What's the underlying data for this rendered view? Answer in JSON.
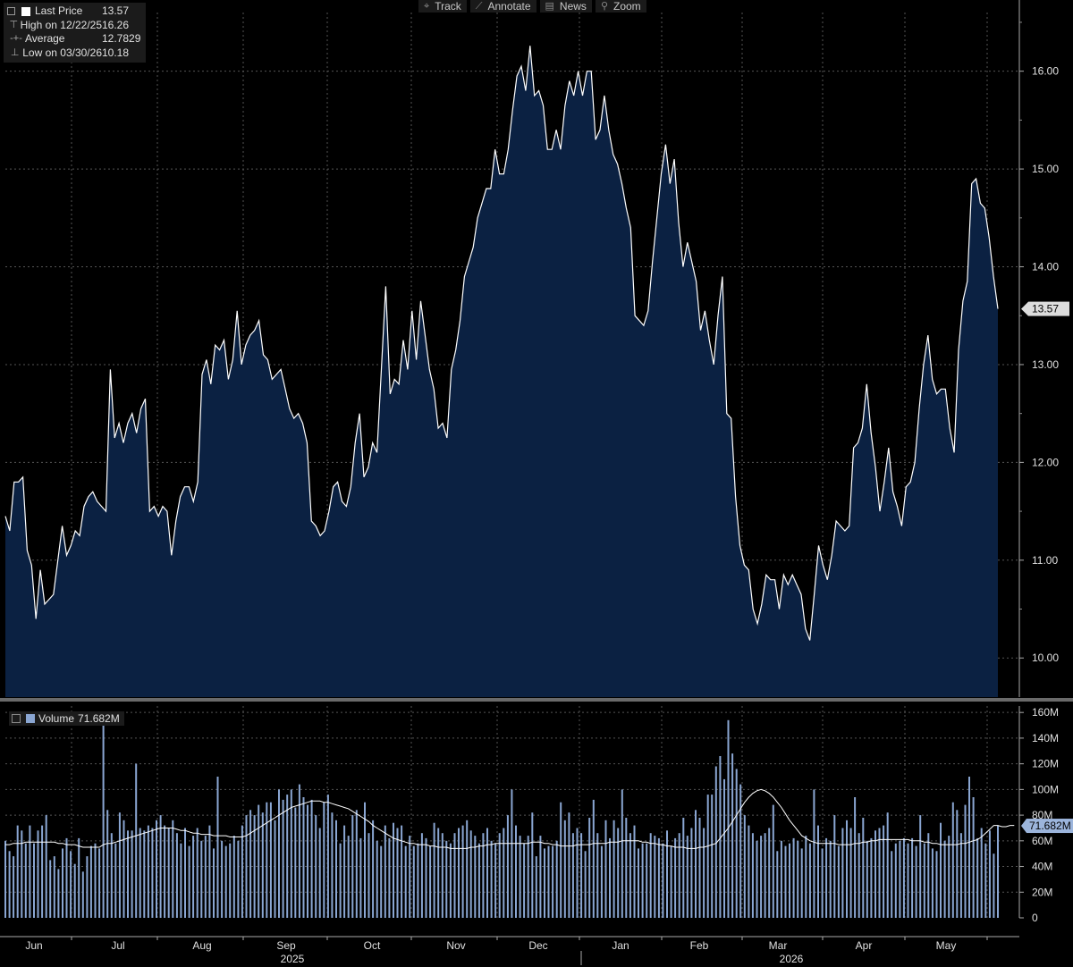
{
  "toolbar": [
    {
      "icon": "crosshair-icon",
      "glyph": "⌖",
      "label": "Track"
    },
    {
      "icon": "pencil-icon",
      "glyph": "⟋",
      "label": "Annotate"
    },
    {
      "icon": "news-icon",
      "glyph": "▤",
      "label": "News"
    },
    {
      "icon": "search-icon",
      "glyph": "⚲",
      "label": "Zoom"
    }
  ],
  "legend": {
    "last_label": "Last Price",
    "last_value": "13.57",
    "high_label": "High on 12/22/25",
    "high_value": "16.26",
    "avg_label": "Average",
    "avg_value": "12.7829",
    "low_label": "Low on 03/30/26",
    "low_value": "10.18"
  },
  "volume_legend": {
    "label": "Volume",
    "value": "71.682M"
  },
  "colors": {
    "line": "#ffffff",
    "area": "#0b2142",
    "volume_bar": "#8aa6d2",
    "grid": "#555555",
    "badge": "#dcdcdc",
    "vol_badge": "#9cb5dc"
  },
  "chart_data": [
    {
      "type": "area",
      "title": "",
      "ylim": [
        9.6,
        16.6
      ],
      "yticks": [
        "10.00",
        "11.00",
        "12.00",
        "13.00",
        "14.00",
        "15.00",
        "16.00"
      ],
      "last_value_badge": "13.57",
      "months": [
        "Jun",
        "Jul",
        "Aug",
        "Sep",
        "Oct",
        "Nov",
        "Dec",
        "Jan",
        "Feb",
        "Mar",
        "Apr",
        "May"
      ],
      "years": [
        "2025",
        "2026"
      ],
      "values": [
        11.45,
        11.3,
        11.8,
        11.8,
        11.85,
        11.1,
        10.95,
        10.4,
        10.9,
        10.55,
        10.6,
        10.65,
        11.0,
        11.35,
        11.05,
        11.15,
        11.3,
        11.25,
        11.55,
        11.65,
        11.7,
        11.6,
        11.55,
        11.5,
        12.95,
        12.25,
        12.4,
        12.2,
        12.4,
        12.5,
        12.3,
        12.55,
        12.65,
        11.5,
        11.55,
        11.45,
        11.55,
        11.5,
        11.05,
        11.4,
        11.65,
        11.75,
        11.75,
        11.6,
        11.8,
        12.9,
        13.05,
        12.8,
        13.2,
        13.15,
        13.25,
        12.85,
        13.05,
        13.55,
        13.0,
        13.2,
        13.3,
        13.35,
        13.45,
        13.1,
        13.05,
        12.85,
        12.9,
        12.95,
        12.75,
        12.55,
        12.45,
        12.5,
        12.4,
        12.2,
        11.4,
        11.35,
        11.25,
        11.3,
        11.5,
        11.75,
        11.8,
        11.6,
        11.55,
        11.75,
        12.2,
        12.5,
        11.85,
        11.95,
        12.2,
        12.1,
        12.95,
        13.8,
        12.7,
        12.85,
        12.8,
        13.25,
        12.95,
        13.55,
        13.05,
        13.65,
        13.3,
        12.95,
        12.75,
        12.35,
        12.4,
        12.25,
        12.95,
        13.15,
        13.45,
        13.9,
        14.05,
        14.2,
        14.5,
        14.65,
        14.8,
        14.8,
        15.2,
        14.95,
        14.95,
        15.2,
        15.6,
        15.95,
        16.05,
        15.8,
        16.26,
        15.75,
        15.8,
        15.65,
        15.2,
        15.2,
        15.4,
        15.2,
        15.65,
        15.9,
        15.75,
        16.0,
        15.75,
        16.0,
        16.0,
        15.3,
        15.4,
        15.75,
        15.4,
        15.15,
        15.05,
        14.85,
        14.6,
        14.4,
        13.5,
        13.45,
        13.4,
        13.55,
        14.05,
        14.5,
        14.95,
        15.25,
        14.85,
        15.1,
        14.45,
        14.0,
        14.25,
        14.05,
        13.85,
        13.35,
        13.55,
        13.25,
        13.0,
        13.5,
        13.9,
        12.5,
        12.45,
        11.65,
        11.15,
        10.95,
        10.9,
        10.5,
        10.35,
        10.55,
        10.85,
        10.8,
        10.8,
        10.5,
        10.85,
        10.75,
        10.85,
        10.75,
        10.65,
        10.3,
        10.18,
        10.65,
        11.15,
        10.95,
        10.8,
        11.05,
        11.4,
        11.35,
        11.3,
        11.35,
        12.15,
        12.2,
        12.35,
        12.8,
        12.3,
        11.95,
        11.5,
        11.8,
        12.15,
        11.7,
        11.55,
        11.35,
        11.75,
        11.8,
        12.0,
        12.55,
        13.0,
        13.3,
        12.85,
        12.7,
        12.75,
        12.75,
        12.35,
        12.1,
        13.15,
        13.65,
        13.85,
        14.85,
        14.9,
        14.65,
        14.6,
        14.3,
        13.9,
        13.57
      ]
    },
    {
      "type": "bar",
      "title": "",
      "ylim": [
        0,
        165
      ],
      "yticks": [
        "0",
        "20M",
        "40M",
        "60M",
        "80M",
        "100M",
        "120M",
        "140M",
        "160M"
      ],
      "last_value_badge": "71.682M",
      "series": [
        {
          "name": "Volume",
          "values": [
            60,
            52,
            48,
            72,
            68,
            58,
            72,
            58,
            68,
            72,
            80,
            45,
            48,
            38,
            54,
            62,
            52,
            42,
            62,
            36,
            48,
            56,
            58,
            54,
            150,
            84,
            66,
            58,
            82,
            76,
            68,
            68,
            120,
            70,
            68,
            72,
            70,
            76,
            80,
            72,
            70,
            76,
            66,
            58,
            70,
            56,
            64,
            70,
            60,
            64,
            72,
            54,
            110,
            60,
            56,
            58,
            64,
            60,
            72,
            80,
            84,
            80,
            88,
            82,
            90,
            90,
            76,
            100,
            92,
            96,
            100,
            86,
            104,
            94,
            88,
            92,
            80,
            70,
            90,
            96,
            82,
            76,
            58,
            72,
            64,
            80,
            84,
            62,
            90,
            66,
            76,
            60,
            56,
            72,
            62,
            74,
            70,
            72,
            56,
            64,
            56,
            58,
            66,
            62,
            56,
            74,
            70,
            66,
            60,
            58,
            66,
            70,
            72,
            76,
            68,
            64,
            58,
            66,
            70,
            60,
            58,
            66,
            70,
            80,
            100,
            72,
            64,
            58,
            64,
            82,
            48,
            64,
            54,
            56,
            56,
            60,
            90,
            76,
            82,
            66,
            70,
            66,
            52,
            78,
            92,
            66,
            56,
            76,
            62,
            76,
            70,
            100,
            78,
            66,
            72,
            54,
            58,
            58,
            66,
            64,
            62,
            58,
            68,
            56,
            62,
            66,
            78,
            64,
            70,
            84,
            78,
            70,
            96,
            96,
            118,
            126,
            108,
            154,
            128,
            116,
            104,
            80,
            72,
            66,
            60,
            64,
            66,
            70,
            88,
            52,
            60,
            56,
            58,
            62,
            60,
            54,
            64,
            58,
            100,
            72,
            54,
            62,
            60,
            80,
            56,
            70,
            76,
            70,
            94,
            66,
            78,
            60,
            62,
            68,
            70,
            72,
            82,
            52,
            58,
            60,
            62,
            58,
            62,
            56,
            80,
            58,
            66,
            54,
            52,
            74,
            60,
            64,
            90,
            84,
            66,
            88,
            110,
            94,
            62,
            70,
            58,
            68,
            50,
            72
          ]
        },
        {
          "name": "",
          "values": [
            57,
            57,
            58,
            58,
            58,
            59,
            59,
            59,
            59,
            59,
            59,
            59,
            59,
            58,
            58,
            57,
            57,
            57,
            56,
            55,
            55,
            55,
            55,
            55,
            57,
            58,
            58,
            59,
            60,
            61,
            62,
            63,
            64,
            65,
            66,
            67,
            68,
            69,
            70,
            70,
            70,
            70,
            69,
            68,
            68,
            67,
            66,
            66,
            65,
            65,
            65,
            64,
            64,
            64,
            64,
            63,
            63,
            63,
            63,
            64,
            66,
            68,
            70,
            72,
            74,
            76,
            78,
            80,
            82,
            84,
            86,
            87,
            88,
            89,
            90,
            91,
            91,
            91,
            90,
            90,
            89,
            88,
            87,
            86,
            85,
            83,
            81,
            79,
            77,
            75,
            72,
            70,
            68,
            66,
            64,
            62,
            61,
            60,
            59,
            58,
            58,
            57,
            57,
            57,
            56,
            56,
            55,
            55,
            55,
            54,
            54,
            54,
            54,
            54,
            55,
            55,
            56,
            56,
            57,
            57,
            58,
            58,
            58,
            58,
            58,
            58,
            58,
            58,
            58,
            59,
            59,
            59,
            58,
            58,
            57,
            57,
            56,
            56,
            56,
            56,
            57,
            57,
            57,
            57,
            58,
            58,
            58,
            58,
            59,
            59,
            59,
            60,
            60,
            60,
            60,
            60,
            59,
            59,
            58,
            58,
            57,
            57,
            56,
            56,
            55,
            55,
            55,
            54,
            54,
            54,
            55,
            55,
            56,
            57,
            58,
            62,
            66,
            70,
            75,
            80,
            85,
            90,
            94,
            97,
            99,
            100,
            99,
            97,
            94,
            90,
            86,
            81,
            76,
            72,
            68,
            64,
            62,
            60,
            59,
            58,
            58,
            58,
            58,
            58,
            57,
            57,
            57,
            57,
            58,
            58,
            59,
            59,
            60,
            60,
            61,
            61,
            61,
            61,
            61,
            61,
            61,
            61,
            60,
            60,
            60,
            59,
            59,
            58,
            58,
            57,
            57,
            57,
            57,
            57,
            58,
            58,
            59,
            60,
            61,
            63,
            66,
            69,
            72,
            72,
            71,
            71,
            72,
            72
          ]
        }
      ]
    }
  ]
}
